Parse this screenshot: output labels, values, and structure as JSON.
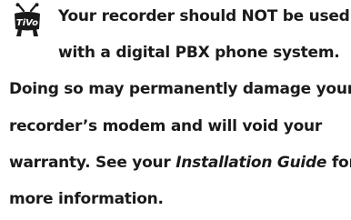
{
  "logo": {
    "icon": "tivo-logo-icon",
    "text": "TiVo"
  },
  "notice": {
    "line1": "Your recorder should NOT be used",
    "line2": "with a digital PBX phone system.",
    "line3": "Doing so may permanently damage your",
    "line4": "recorder’s modem and will void your",
    "line5_prefix": "warranty. See your ",
    "line5_italic": "Installation Guide",
    "line5_suffix": " for",
    "line6": "more information."
  }
}
